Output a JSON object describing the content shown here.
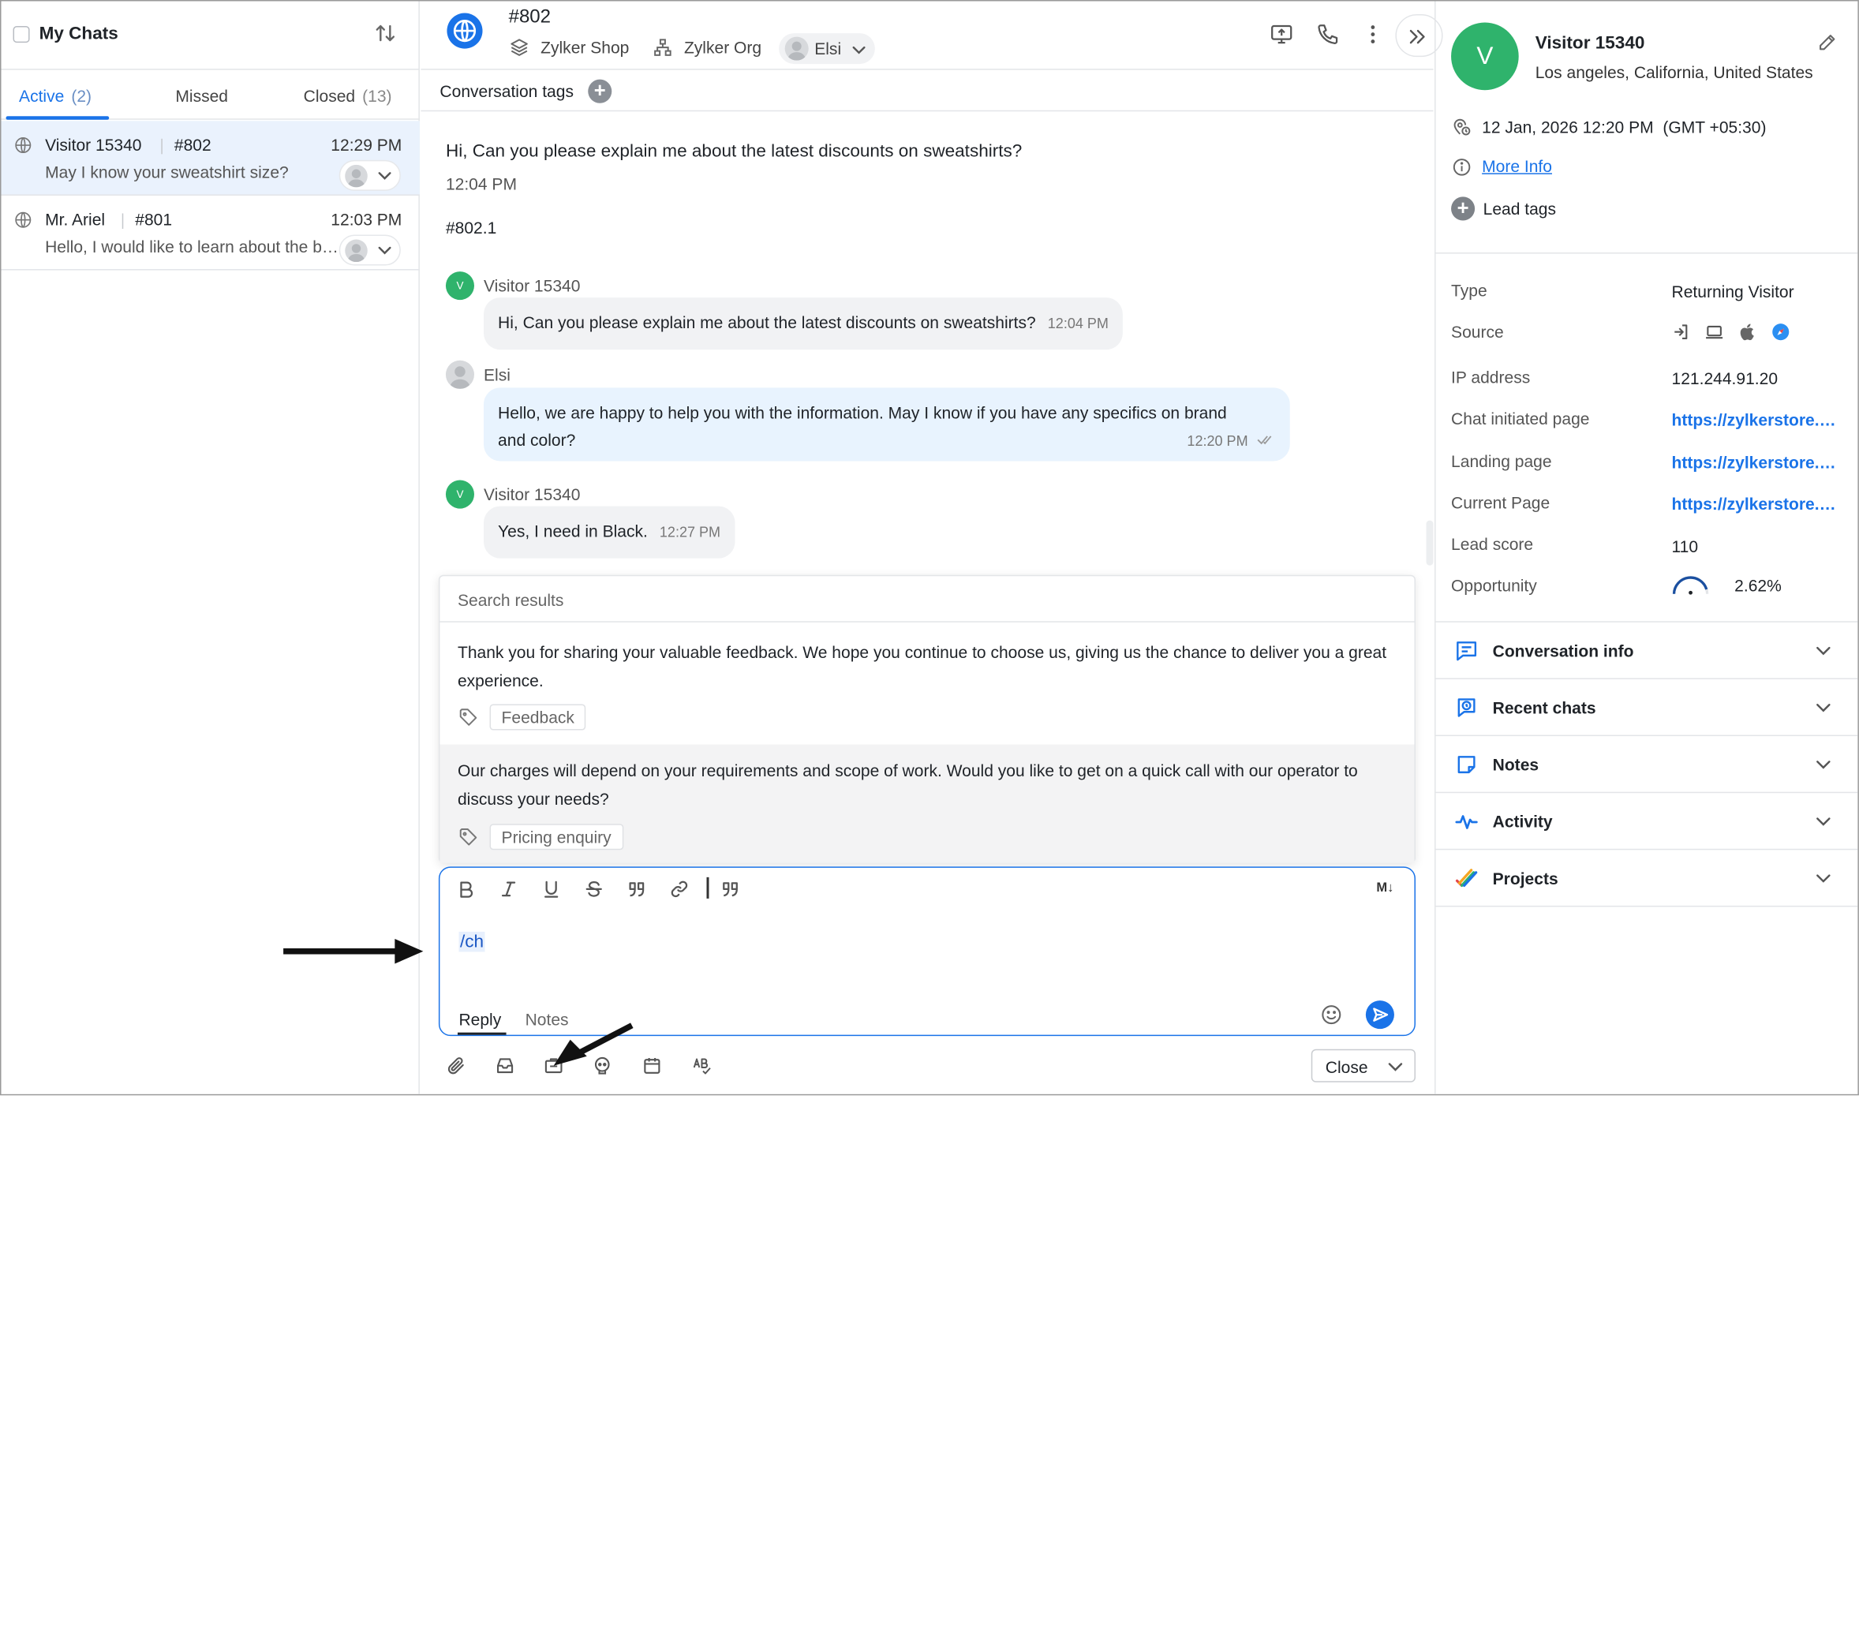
{
  "left": {
    "title": "My Chats",
    "tabs": [
      {
        "label": "Active",
        "count": "(2)"
      },
      {
        "label": "Missed",
        "count": ""
      },
      {
        "label": "Closed",
        "count": "(13)"
      }
    ],
    "chats": [
      {
        "name": "Visitor 15340",
        "id": "#802",
        "time": "12:29 PM",
        "message": "May I know your sweatshirt size?",
        "selected": true
      },
      {
        "name": "Mr. Ariel",
        "id": "#801",
        "time": "12:03 PM",
        "message": "Hello, I would like to learn about the best discounts",
        "selected": false
      }
    ]
  },
  "header": {
    "chat_id": "#802",
    "brand": "Zylker Shop",
    "org": "Zylker Org",
    "assignee": "Elsi"
  },
  "conversation": {
    "tags_label": "Conversation tags",
    "question": "Hi, Can you please explain me about the latest discounts on sweatshirts?",
    "question_time": "12:04 PM",
    "sub_id": "#802.1",
    "messages": [
      {
        "sender": "Visitor 15340",
        "avatar": "V",
        "text": "Hi, Can you please explain me about the latest discounts on sweatshirts?",
        "time": "12:04 PM"
      },
      {
        "sender": "Elsi",
        "text_line1": "Hello, we are happy to help you with the information. May I know if you have any specifics on brand",
        "text_line2": "and color?",
        "time": "12:20 PM"
      },
      {
        "sender": "Visitor 15340",
        "avatar": "V",
        "text": "Yes, I need in Black.",
        "time": "12:27 PM"
      }
    ]
  },
  "canned": {
    "header": "Search results",
    "results": [
      {
        "text": "Thank you for sharing your valuable feedback. We hope you continue to choose us, giving us the chance to deliver you a great experience.",
        "tag": "Feedback"
      },
      {
        "text": "Our charges will depend on your requirements and scope of work. Would you like to get on a quick call with our operator to discuss your needs?",
        "tag": "Pricing enquiry"
      }
    ]
  },
  "composer": {
    "text": "/ch",
    "markdown_label": "M↓",
    "mode_reply": "Reply",
    "mode_notes": "Notes",
    "close_label": "Close"
  },
  "visitor": {
    "avatar": "V",
    "name": "Visitor 15340",
    "location": "Los angeles, California, United States",
    "datetime": "12 Jan, 2026 12:20 PM  (GMT +05:30)",
    "more_info": "More Info",
    "lead_tags": "Lead tags",
    "props": [
      {
        "label": "Type",
        "value": "Returning Visitor"
      },
      {
        "label": "Source",
        "value": ""
      },
      {
        "label": "IP address",
        "value": "121.244.91.20"
      },
      {
        "label": "Chat initiated page",
        "value": "https://zylkerstore.com/sweatshirts"
      },
      {
        "label": "Landing page",
        "value": "https://zylkerstore.com/"
      },
      {
        "label": "Current Page",
        "value": "https://zylkerstore.com/sweatshirts"
      },
      {
        "label": "Lead score",
        "value": "110"
      },
      {
        "label": "Opportunity",
        "value": "2.62%"
      }
    ],
    "sections": [
      "Conversation info",
      "Recent chats",
      "Notes",
      "Activity",
      "Projects"
    ]
  },
  "colors": {
    "accent": "#1a73e8",
    "visitor_avatar": "#2fb36c",
    "operator_bubble": "#e8f3fe"
  },
  "icons": [
    "sort-icon",
    "globe-icon",
    "layers-icon",
    "org-icon",
    "screen-share-icon",
    "phone-icon",
    "more-icon",
    "expand-icon",
    "tag-icon",
    "bold-icon",
    "italic-icon",
    "underline-icon",
    "strikethrough-icon",
    "blockquote-icon",
    "link-icon",
    "quote-icon",
    "emoji-icon",
    "send-icon",
    "attach-icon",
    "inbox-icon",
    "canned-response-icon",
    "bot-icon",
    "calendar-icon",
    "spellcheck-icon",
    "edit-icon",
    "location-icon",
    "info-icon",
    "plus-icon"
  ]
}
